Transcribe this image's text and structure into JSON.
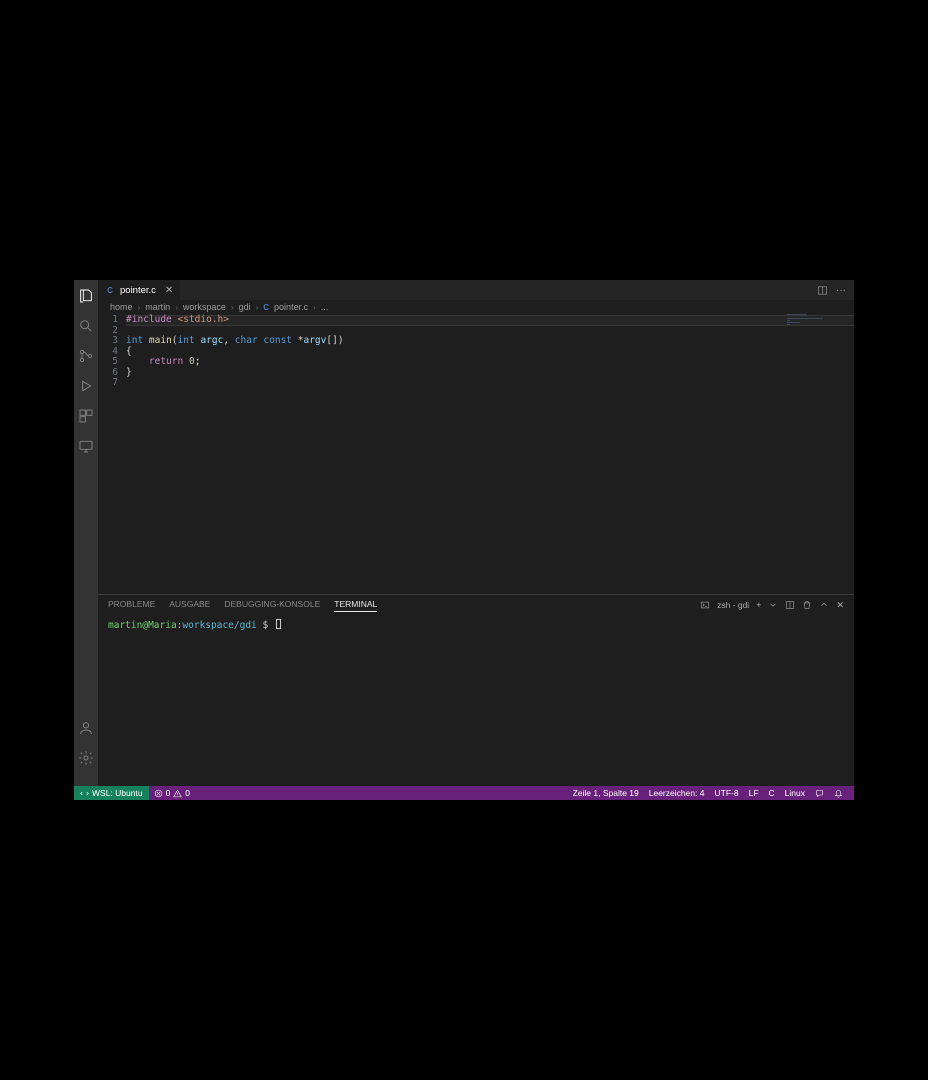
{
  "tab": {
    "filename": "pointer.c",
    "lang_badge": "C"
  },
  "breadcrumbs": {
    "parts": [
      "home",
      "martin",
      "workspace",
      "gdi"
    ],
    "file_badge": "C",
    "file": "pointer.c",
    "tail": "..."
  },
  "code": {
    "line_numbers": [
      "1",
      "2",
      "3",
      "4",
      "5",
      "6",
      "7"
    ],
    "l1_include": "#include",
    "l1_header": "<stdio.h>",
    "l3_int": "int",
    "l3_main": "main",
    "l3_open": "(",
    "l3_int2": "int",
    "l3_argc": "argc",
    "l3_comma": ", ",
    "l3_char": "char",
    "l3_const": "const",
    "l3_star": " *",
    "l3_argv": "argv",
    "l3_brk": "[]",
    "l3_close": ")",
    "l4_brace": "{",
    "l5_return": "return",
    "l5_zero": "0",
    "l5_semi": ";",
    "l6_brace": "}"
  },
  "panel": {
    "tabs": {
      "problems": "PROBLEME",
      "output": "AUSGABE",
      "debug": "DEBUGGING-KONSOLE",
      "terminal": "TERMINAL"
    },
    "terminal_name": "zsh - gdi",
    "prompt": {
      "user": "martin",
      "at": "@",
      "host": "Maria",
      "colon": ":",
      "path": "workspace/gdi",
      "sym": " $ "
    }
  },
  "status": {
    "remote": "WSL: Ubuntu",
    "errors": "0",
    "warnings": "0",
    "cursor": "Zeile 1, Spalte 19",
    "indent": "Leerzeichen: 4",
    "encoding": "UTF-8",
    "eol": "LF",
    "lang": "C",
    "os": "Linux"
  }
}
